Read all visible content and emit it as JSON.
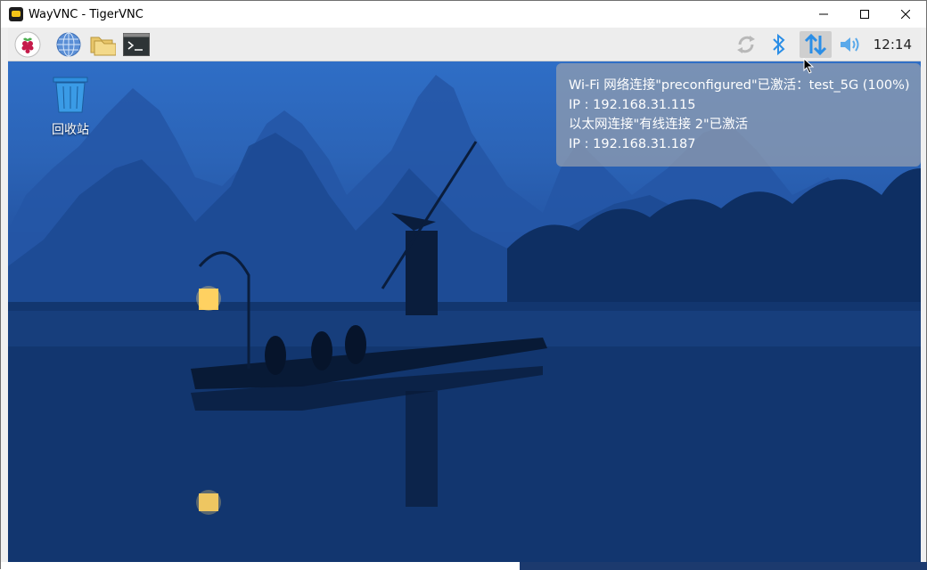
{
  "window": {
    "title": "WayVNC - TigerVNC"
  },
  "panel": {
    "launchers": [
      {
        "name": "raspberry-menu-icon"
      },
      {
        "name": "web-browser-icon"
      },
      {
        "name": "file-manager-icon"
      },
      {
        "name": "terminal-icon"
      }
    ],
    "tray": [
      "network-sync-icon",
      "bluetooth-icon",
      "network-updown-icon",
      "volume-icon"
    ],
    "clock": "12:14"
  },
  "desktop": {
    "trash_label": "回收站"
  },
  "tooltip": {
    "line1": "Wi-Fi 网络连接\"preconfigured\"已激活：test_5G (100%)",
    "line2": "IP : 192.168.31.115",
    "line3": "以太网连接\"有线连接 2\"已激活",
    "line4": "IP : 192.168.31.187"
  },
  "colors": {
    "tray_accent": "#2b8ee6",
    "panel_bg": "#ededed",
    "raspberry_red": "#c51a4a"
  }
}
